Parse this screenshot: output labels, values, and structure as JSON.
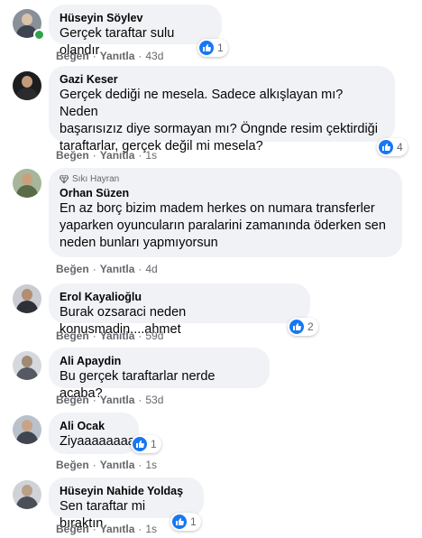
{
  "separator": "·",
  "comments": [
    {
      "name": "Hüseyin Söylev",
      "text": [
        "Gerçek taraftar sulu olandır"
      ],
      "reactions": "1",
      "like": "Beğen",
      "reply": "Yanıtla",
      "time": "43d",
      "online": true,
      "avatar_colors": [
        "#8a9098",
        "#d9c3a8",
        "#3d4450"
      ]
    },
    {
      "name": "Gazi Keser",
      "text": [
        "Gerçek dediği ne mesela. Sadece alkışlayan mı? Neden",
        "başarısızız diye sormayan mı? Öngnde resim çektirdiği",
        "taraftarlar, gerçek değil mi mesela?"
      ],
      "reactions": "4",
      "like": "Beğen",
      "reply": "Yanıtla",
      "time": "1s",
      "avatar_colors": [
        "#1d1d1f",
        "#c49a7a",
        "#2b2b2e"
      ]
    },
    {
      "badge": "Sıkı Hayran",
      "name": "Orhan Süzen",
      "text": [
        "En az borç bizim madem herkes on numara transferler",
        "yaparken oyuncuların paralarini zamanında öderken sen",
        "neden bunları yapmıyorsun"
      ],
      "like": "Beğen",
      "reply": "Yanıtla",
      "time": "4d",
      "avatar_colors": [
        "#a7b59a",
        "#caa07c",
        "#5a6b4a"
      ]
    },
    {
      "name": "Erol Kayalioğlu",
      "text": [
        "Burak ozsaraci neden konusmadin....ahmet"
      ],
      "reactions": "2",
      "like": "Beğen",
      "reply": "Yanıtla",
      "time": "59d",
      "avatar_colors": [
        "#c9ccd2",
        "#b48e70",
        "#2e3138"
      ]
    },
    {
      "name": "Ali Apaydin",
      "text": [
        "Bu gerçek taraftarlar nerde acaba?"
      ],
      "like": "Beğen",
      "reply": "Yanıtla",
      "time": "53d",
      "avatar_colors": [
        "#d5d8dc",
        "#9f8a76",
        "#555a62"
      ]
    },
    {
      "name": "Ali Ocak",
      "text": [
        "Ziyaaaaaaaa"
      ],
      "reactions": "1",
      "like": "Beğen",
      "reply": "Yanıtla",
      "time": "1s",
      "avatar_colors": [
        "#b9c2cc",
        "#c7a487",
        "#3f4650"
      ]
    },
    {
      "name": "Hüseyin Nahide Yoldaş",
      "text": [
        "Sen taraftar mi bıraktın."
      ],
      "reactions": "1",
      "like": "Beğen",
      "reply": "Yanıtla",
      "time": "1s",
      "avatar_colors": [
        "#cfd3d8",
        "#b9a089",
        "#4b5058"
      ]
    }
  ],
  "colors": {
    "like_blue": "#1877f2",
    "bubble_bg": "#f0f2f5",
    "meta_gray": "#65676b",
    "online_green": "#31a24c"
  },
  "icons": {
    "like": "thumbs-up-icon",
    "badge": "diamond-icon"
  }
}
